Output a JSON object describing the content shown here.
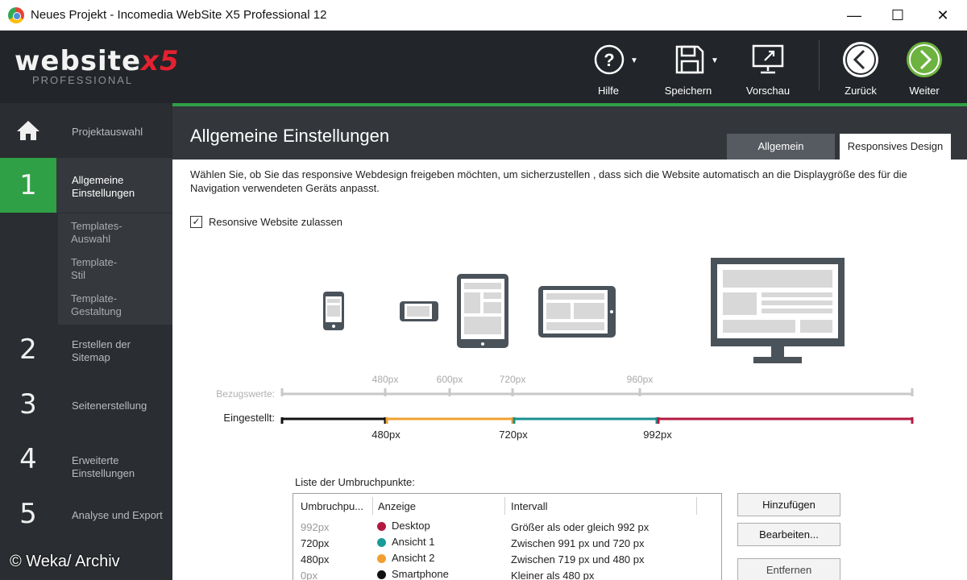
{
  "window": {
    "title": "Neues Projekt - Incomedia WebSite X5 Professional 12",
    "minimize_glyph": "—",
    "maximize_glyph": "☐",
    "close_glyph": "✕"
  },
  "logo": {
    "main_prefix": "website",
    "main_suffix": "x5",
    "sub": "PROFESSIONAL"
  },
  "toolbar": {
    "help": {
      "label": "Hilfe",
      "icon": "help-icon"
    },
    "save": {
      "label": "Speichern",
      "icon": "save-icon"
    },
    "preview": {
      "label": "Vorschau",
      "icon": "monitor-icon"
    },
    "back": {
      "label": "Zurück",
      "icon": "arrow-left-icon"
    },
    "next": {
      "label": "Weiter",
      "icon": "arrow-right-icon"
    }
  },
  "sidebar": {
    "items": [
      {
        "num": "",
        "label": "Projektauswahl",
        "icon": "home-icon"
      },
      {
        "num": "1",
        "label": "Allgemeine Einstellungen",
        "active": true
      },
      {
        "num": "2",
        "label": "Erstellen der Sitemap"
      },
      {
        "num": "3",
        "label": "Seitenerstellung"
      },
      {
        "num": "4",
        "label": "Erweiterte Einstellungen"
      },
      {
        "num": "5",
        "label": "Analyse und Export"
      }
    ],
    "subitems": [
      {
        "label": "Templates-Auswahl"
      },
      {
        "label": "Template-Stil"
      },
      {
        "label": "Template-Gestaltung"
      }
    ]
  },
  "watermark": "© Weka/ Archiv",
  "header": {
    "title": "Allgemeine Einstellungen",
    "tabs": [
      {
        "label": "Allgemein"
      },
      {
        "label": "Responsives Design",
        "selected": true
      }
    ]
  },
  "content": {
    "description": "Wählen Sie, ob Sie das responsive Webdesign freigeben  möchten, um sicherzustellen , dass sich die Website automatisch an die Displaygröße des für die Navigation verwendeten Geräts anpasst.",
    "checkbox_label": "Resonsive Website zulassen",
    "checkbox_checked": true,
    "checkbox_mark": "✓",
    "scale": {
      "reference_label": "Bezugswerte:",
      "reference_ticks": [
        "480px",
        "600px",
        "720px",
        "960px"
      ],
      "set_label": "Eingestellt:",
      "set_ticks": [
        "480px",
        "720px",
        "992px"
      ],
      "segment_colors": [
        "#111111",
        "#f0a030",
        "#1a8f8f",
        "#b3193f"
      ]
    },
    "list_title": "Liste der Umbruchpunkte:",
    "list": {
      "headers": [
        "Umbruchpu...",
        "Anzeige",
        "Intervall"
      ],
      "rows": [
        {
          "point": "992px",
          "display": "Desktop",
          "color": "#b3193f",
          "interval": "Größer als oder gleich 992 px",
          "dim": true
        },
        {
          "point": "720px",
          "display": "Ansicht 1",
          "color": "#1a9a9a",
          "interval": "Zwischen 991 px und 720 px"
        },
        {
          "point": "480px",
          "display": "Ansicht 2",
          "color": "#f0a030",
          "interval": "Zwischen 719 px und 480 px"
        },
        {
          "point": "0px",
          "display": "Smartphone",
          "color": "#111111",
          "interval": "Kleiner als 480 px",
          "dim": true
        }
      ]
    },
    "buttons": {
      "add": "Hinzufügen",
      "edit": "Bearbeiten...",
      "remove": "Entfernen"
    }
  }
}
